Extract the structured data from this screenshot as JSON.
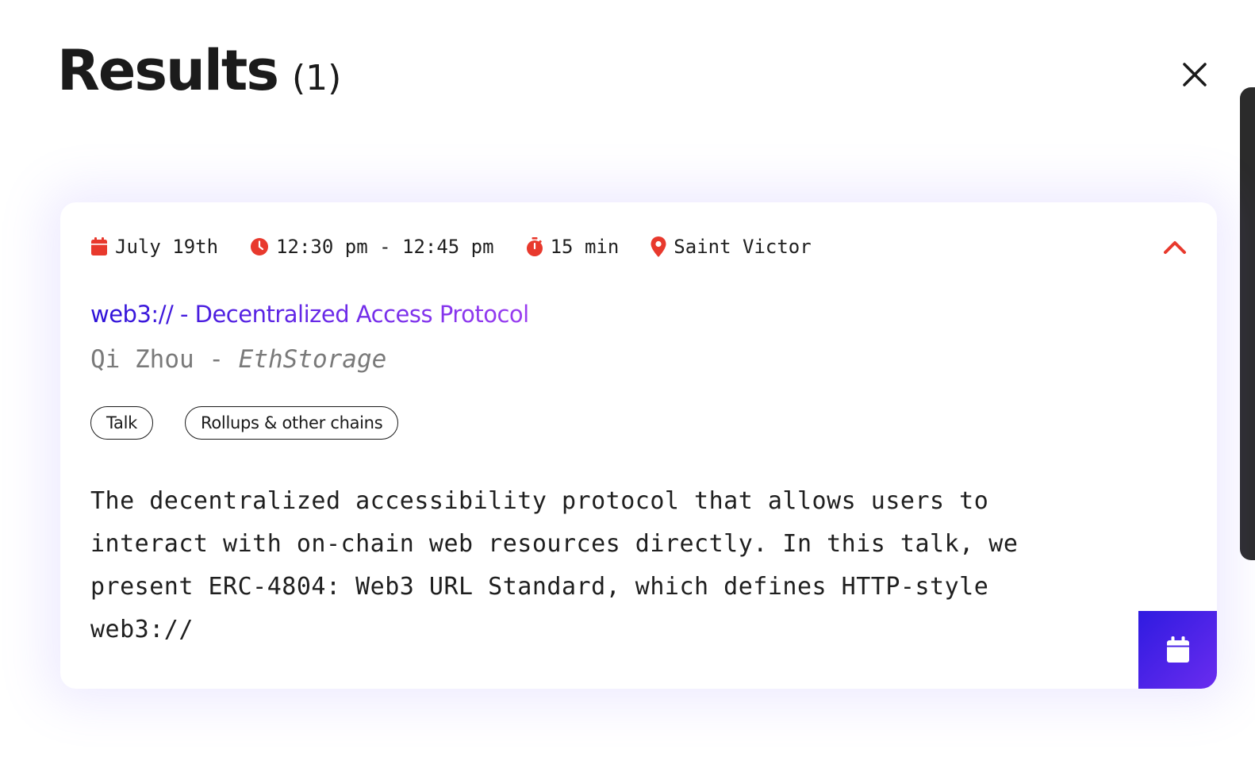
{
  "header": {
    "title": "Results",
    "count": "(1)"
  },
  "icons": {
    "close": "close-icon",
    "calendar": "calendar-icon",
    "clock": "clock-icon",
    "stopwatch": "stopwatch-icon",
    "location": "location-pin-icon",
    "collapse": "chevron-up-icon"
  },
  "colors": {
    "accent_red": "#e8392d",
    "title_gradient_start": "#2d12d8",
    "title_gradient_end": "#9a3df0",
    "button_gradient_start": "#2f1be0",
    "button_gradient_end": "#6a2cef"
  },
  "event": {
    "date": "July 19th",
    "time": "12:30 pm - 12:45 pm",
    "duration": "15 min",
    "location": "Saint Victor",
    "title": "web3:// - Decentralized Access Protocol",
    "speaker": "Qi Zhou",
    "speaker_separator": " - ",
    "organization": "EthStorage",
    "tags": [
      "Talk",
      "Rollups & other chains"
    ],
    "description": "The decentralized accessibility protocol that allows users to interact with on-chain web resources directly. In this talk, we present ERC-4804: Web3 URL Standard, which defines HTTP-style web3://"
  }
}
